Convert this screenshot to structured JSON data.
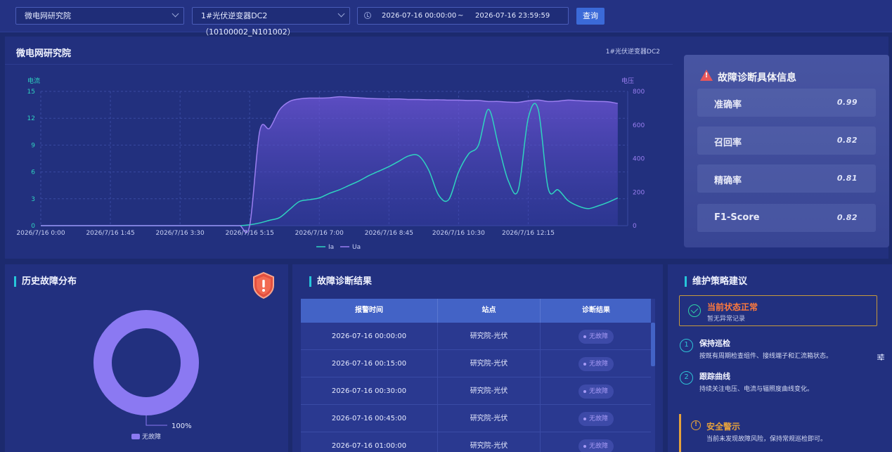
{
  "filters": {
    "station": "微电网研究院",
    "device": "1#光伏逆变器DC2（10100002_N101002）",
    "start_time": "2026-07-16 00:00:00",
    "range_sep": "~",
    "end_time": "2026-07-16 23:59:59",
    "query_label": "查询"
  },
  "chart_panel": {
    "title": "微电网研究院",
    "device_label": "1#光伏逆变器DC2"
  },
  "chart_data": {
    "type": "line",
    "x_tick_labels": [
      "2026/7/16 0:00",
      "2026/7/16 1:45",
      "2026/7/16 3:30",
      "2026/7/16 5:15",
      "2026/7/16 7:00",
      "2026/7/16 8:45",
      "2026/7/16 10:30",
      "2026/7/16 12:15"
    ],
    "x_hours": [
      0,
      0.25,
      0.5,
      0.75,
      1,
      1.25,
      1.5,
      1.75,
      2,
      2.25,
      2.5,
      2.75,
      3,
      3.25,
      3.5,
      3.75,
      4,
      4.25,
      4.5,
      4.75,
      5,
      5.25,
      5.5,
      5.75,
      6,
      6.25,
      6.5,
      6.75,
      7,
      7.25,
      7.5,
      7.75,
      8,
      8.25,
      8.5,
      8.75,
      9,
      9.25,
      9.5,
      9.75,
      10,
      10.25,
      10.5,
      10.75,
      11,
      11.25,
      11.5,
      11.75,
      12,
      12.25,
      12.5,
      12.75,
      13,
      13.25,
      13.5,
      13.75,
      14,
      14.25,
      14.5
    ],
    "left_axis": {
      "label": "电流",
      "ticks": [
        0,
        3,
        6,
        9,
        12,
        15
      ],
      "ylim": [
        0,
        15
      ]
    },
    "right_axis": {
      "label": "电压",
      "ticks": [
        0,
        200,
        400,
        600,
        800
      ],
      "ylim": [
        0,
        800
      ]
    },
    "series": [
      {
        "name": "Ia",
        "axis": "left",
        "color": "#2fd3c0",
        "values": [
          0,
          0,
          0,
          0,
          0,
          0,
          0,
          0,
          0,
          0,
          0,
          0,
          0,
          0,
          0,
          0,
          0,
          0,
          0,
          0,
          0,
          0.1,
          0.3,
          0.6,
          0.9,
          1.8,
          2.7,
          2.9,
          3.1,
          3.6,
          4.0,
          4.5,
          5.0,
          5.6,
          6.1,
          6.6,
          7.2,
          7.8,
          7.8,
          6.2,
          3.4,
          2.9,
          6.0,
          8.0,
          9.0,
          13.0,
          9.0,
          5.0,
          4.0,
          12.0,
          13.0,
          4.2,
          4.0,
          2.8,
          2.2,
          1.9,
          2.2,
          2.6,
          3.1
        ],
        "y_extra": "Ia at 10:35 approx 2.9 / 11:05 approx 3.7 / 12:38 approx 10.0"
      },
      {
        "name": "Ua",
        "axis": "right",
        "color": "#9a7ef0",
        "values": [
          0,
          0,
          0,
          0,
          0,
          0,
          0,
          0,
          0,
          0,
          0,
          0,
          0,
          0,
          0,
          0,
          0,
          0,
          0,
          0,
          0,
          0,
          560,
          580,
          690,
          740,
          755,
          760,
          760,
          762,
          768,
          765,
          762,
          758,
          756,
          755,
          755,
          752,
          752,
          750,
          750,
          748,
          748,
          746,
          746,
          740,
          740,
          736,
          735,
          744,
          748,
          740,
          742,
          748,
          745,
          742,
          740,
          738,
          728
        ]
      }
    ],
    "legend": {
      "placement": "bottom",
      "entries": [
        "Ia",
        "Ua"
      ]
    },
    "grid": true
  },
  "metrics_card": {
    "title": "故障诊断具体信息",
    "items": [
      {
        "label": "准确率",
        "value": "0.99"
      },
      {
        "label": "召回率",
        "value": "0.82"
      },
      {
        "label": "精确率",
        "value": "0.81"
      },
      {
        "label": "F1-Score",
        "value": "0.82"
      }
    ]
  },
  "history": {
    "title": "历史故障分布",
    "donut": {
      "type": "pie",
      "slices": [
        {
          "name": "无故障",
          "value": 100,
          "color": "#8b79f2"
        }
      ]
    },
    "percent_label": "100%",
    "legend_label": "无故障"
  },
  "results": {
    "title": "故障诊断结果",
    "columns": [
      "报警时间",
      "站点",
      "诊断结果"
    ],
    "rows": [
      {
        "time": "2026-07-16 00:00:00",
        "site": "研究院-光伏",
        "result": "无故障"
      },
      {
        "time": "2026-07-16 00:15:00",
        "site": "研究院-光伏",
        "result": "无故障"
      },
      {
        "time": "2026-07-16 00:30:00",
        "site": "研究院-光伏",
        "result": "无故障"
      },
      {
        "time": "2026-07-16 00:45:00",
        "site": "研究院-光伏",
        "result": "无故障"
      },
      {
        "time": "2026-07-16 01:00:00",
        "site": "研究院-光伏",
        "result": "无故障"
      }
    ]
  },
  "strategy": {
    "title": "维护策略建议",
    "status_title": "当前状态正常",
    "status_sub": "暂无异常记录",
    "steps": [
      {
        "num": "1",
        "title": "保持巡检",
        "desc": "按既有周期检查组件、接线端子和汇流箱状态。"
      },
      {
        "num": "2",
        "title": "跟踪曲线",
        "desc": "持续关注电压、电流与辐照度曲线变化。"
      }
    ],
    "safety_title": "安全警示",
    "safety_text": "当前未发现故障风险，保持常规巡检即可。"
  }
}
